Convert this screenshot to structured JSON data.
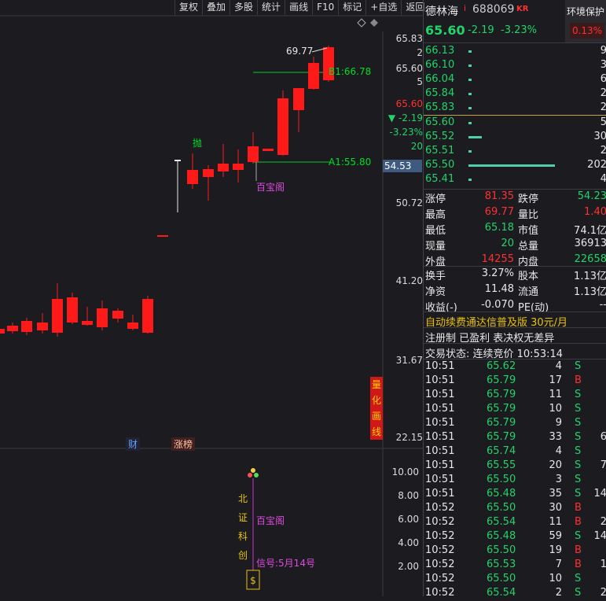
{
  "toolbar": {
    "buttons": [
      "复权",
      "叠加",
      "多股",
      "统计",
      "画线",
      "F10",
      "标记",
      "+自选",
      "返回"
    ]
  },
  "chart": {
    "y_labels": [
      "65.83",
      "65.60",
      "50.72",
      "41.20",
      "31.67",
      "22.15"
    ],
    "y_side_nums": [
      "2",
      "5"
    ],
    "price_box": "54.53",
    "quote_overlay": {
      "price": "65.60",
      "change": "-2.19",
      "pct": "-3.23%",
      "vol": "20"
    },
    "high_label": "69.77",
    "line_b": "B1:66.78",
    "line_a": "A1:55.80",
    "tag_pao": "抛",
    "tag_bbg_main": "百宝阁",
    "bottom_tags": [
      "财",
      "涨榜"
    ],
    "side_vertical": [
      "量",
      "化",
      "画",
      "线"
    ],
    "sub_y_labels": [
      "10.00",
      "8.00",
      "6.00",
      "4.00",
      "2.00"
    ],
    "sub_vertical": [
      "北",
      "证",
      "科",
      "创"
    ],
    "sub_bbg": "百宝阁",
    "sub_signal": "信号:5月14号",
    "colors": {
      "up": "#ff1a1a",
      "down": "#22d36a",
      "line_a": "#00cc22"
    }
  },
  "header": {
    "name": "德林海",
    "code": "688069",
    "badge": "i",
    "kr": "KR",
    "protect_label": "环境保护",
    "price": "65.60",
    "change": "-2.19",
    "pct": "-3.23%",
    "protect_pct": "0.13%"
  },
  "sell_book": [
    {
      "price": "66.13",
      "vol": "9",
      "bar": 0.02
    },
    {
      "price": "66.10",
      "vol": "3",
      "bar": 0.01
    },
    {
      "price": "66.04",
      "vol": "6",
      "bar": 0.02
    },
    {
      "price": "65.84",
      "vol": "2",
      "bar": 0.01
    },
    {
      "price": "65.83",
      "vol": "2",
      "bar": 0.01
    }
  ],
  "buy_book": [
    {
      "price": "65.60",
      "vol": "5",
      "bar": 0.01
    },
    {
      "price": "65.52",
      "vol": "30",
      "bar": 0.15
    },
    {
      "price": "65.51",
      "vol": "2",
      "bar": 0.01
    },
    {
      "price": "65.50",
      "vol": "202",
      "bar": 1.0
    },
    {
      "price": "65.41",
      "vol": "4",
      "bar": 0.01
    }
  ],
  "stats": [
    [
      "涨停",
      "81.35",
      "跌停",
      "54.23"
    ],
    [
      "最高",
      "69.77",
      "量比",
      "1.40"
    ],
    [
      "最低",
      "65.18",
      "市值",
      "74.1亿"
    ],
    [
      "现量",
      "20",
      "总量",
      "36913"
    ],
    [
      "外盘",
      "14255",
      "内盘",
      "22658"
    ]
  ],
  "stats2": [
    [
      "换手",
      "3.27%",
      "股本",
      "1.13亿"
    ],
    [
      "净资",
      "11.48",
      "流通",
      "1.13亿"
    ],
    [
      "收益(-)",
      "-0.070",
      "PE(动)",
      "--"
    ]
  ],
  "promo": "自动续费通达信普及版  30元/月",
  "flags": "注册制 已盈利 表决权无差异",
  "trade_status": "交易状态: 连续竞价 10:53:14",
  "ticks": [
    [
      "10:51",
      "65.62",
      "4",
      "S"
    ],
    [
      "10:51",
      "65.79",
      "17",
      "B"
    ],
    [
      "10:51",
      "65.79",
      "11",
      "S"
    ],
    [
      "10:51",
      "65.79",
      "10",
      "S"
    ],
    [
      "10:51",
      "65.79",
      "9",
      "S"
    ],
    [
      "10:51",
      "65.79",
      "33",
      "S"
    ],
    [
      "10:51",
      "65.74",
      "4",
      "S"
    ],
    [
      "10:51",
      "65.55",
      "20",
      "S"
    ],
    [
      "10:51",
      "65.50",
      "3",
      "S"
    ],
    [
      "10:51",
      "65.48",
      "35",
      "S"
    ],
    [
      "10:52",
      "65.50",
      "30",
      "B"
    ],
    [
      "10:52",
      "65.54",
      "11",
      "B"
    ],
    [
      "10:52",
      "65.48",
      "59",
      "S"
    ],
    [
      "10:52",
      "65.50",
      "19",
      "B"
    ],
    [
      "10:52",
      "65.53",
      "7",
      "B"
    ],
    [
      "10:52",
      "65.50",
      "10",
      "S"
    ],
    [
      "10:52",
      "65.54",
      "2",
      "S"
    ]
  ],
  "tick_tail": [
    "",
    "",
    "",
    "",
    "",
    "6",
    "",
    "7",
    "",
    "14",
    "",
    "2",
    "14",
    "",
    "1",
    "",
    "2"
  ]
}
